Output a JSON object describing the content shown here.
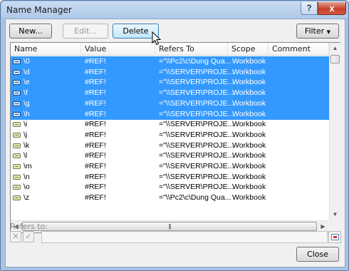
{
  "window": {
    "title": "Name Manager",
    "help": "?",
    "close": "x"
  },
  "toolbar": {
    "new_label": "New...",
    "edit_label": "Edit...",
    "delete_label": "Delete",
    "filter_label": "Filter"
  },
  "columns": [
    "Name",
    "Value",
    "Refers To",
    "Scope",
    "Comment"
  ],
  "rows": [
    {
      "name": "\\0",
      "value": "#REF!",
      "refers": "=\"\\\\Pc2\\c\\Dung Qua...",
      "scope": "Workbook",
      "comment": "",
      "selected": true
    },
    {
      "name": "\\d",
      "value": "#REF!",
      "refers": "=\"\\\\SERVER\\PROJE...",
      "scope": "Workbook",
      "comment": "",
      "selected": true
    },
    {
      "name": "\\e",
      "value": "#REF!",
      "refers": "=\"\\\\SERVER\\PROJE...",
      "scope": "Workbook",
      "comment": "",
      "selected": true
    },
    {
      "name": "\\f",
      "value": "#REF!",
      "refers": "=\"\\\\SERVER\\PROJE...",
      "scope": "Workbook",
      "comment": "",
      "selected": true
    },
    {
      "name": "\\g",
      "value": "#REF!",
      "refers": "=\"\\\\SERVER\\PROJE...",
      "scope": "Workbook",
      "comment": "",
      "selected": true
    },
    {
      "name": "\\h",
      "value": "#REF!",
      "refers": "=\"\\\\SERVER\\PROJE...",
      "scope": "Workbook",
      "comment": "",
      "selected": true
    },
    {
      "name": "\\i",
      "value": "#REF!",
      "refers": "=\"\\\\SERVER\\PROJE...",
      "scope": "Workbook",
      "comment": "",
      "selected": false
    },
    {
      "name": "\\j",
      "value": "#REF!",
      "refers": "=\"\\\\SERVER\\PROJE...",
      "scope": "Workbook",
      "comment": "",
      "selected": false
    },
    {
      "name": "\\k",
      "value": "#REF!",
      "refers": "=\"\\\\SERVER\\PROJE...",
      "scope": "Workbook",
      "comment": "",
      "selected": false
    },
    {
      "name": "\\l",
      "value": "#REF!",
      "refers": "=\"\\\\SERVER\\PROJE...",
      "scope": "Workbook",
      "comment": "",
      "selected": false
    },
    {
      "name": "\\m",
      "value": "#REF!",
      "refers": "=\"\\\\SERVER\\PROJE...",
      "scope": "Workbook",
      "comment": "",
      "selected": false
    },
    {
      "name": "\\n",
      "value": "#REF!",
      "refers": "=\"\\\\SERVER\\PROJE...",
      "scope": "Workbook",
      "comment": "",
      "selected": false
    },
    {
      "name": "\\o",
      "value": "#REF!",
      "refers": "=\"\\\\SERVER\\PROJE...",
      "scope": "Workbook",
      "comment": "",
      "selected": false
    },
    {
      "name": "\\z",
      "value": "#REF!",
      "refers": "=\"\\\\Pc2\\c\\Dung Qua...",
      "scope": "Workbook",
      "comment": "",
      "selected": false
    }
  ],
  "refers_to": {
    "label": "Refers to:",
    "value": "",
    "cancel": "✕",
    "confirm": "✓"
  },
  "footer": {
    "close_label": "Close"
  },
  "icons": {
    "name_row": "name-range-icon",
    "collapse": "collapse-dialog-icon",
    "cursor": "mouse-pointer-icon"
  },
  "colors": {
    "selection": "#3399ff",
    "title_gradient": "#afc9e8",
    "close_red": "#c8402b"
  }
}
